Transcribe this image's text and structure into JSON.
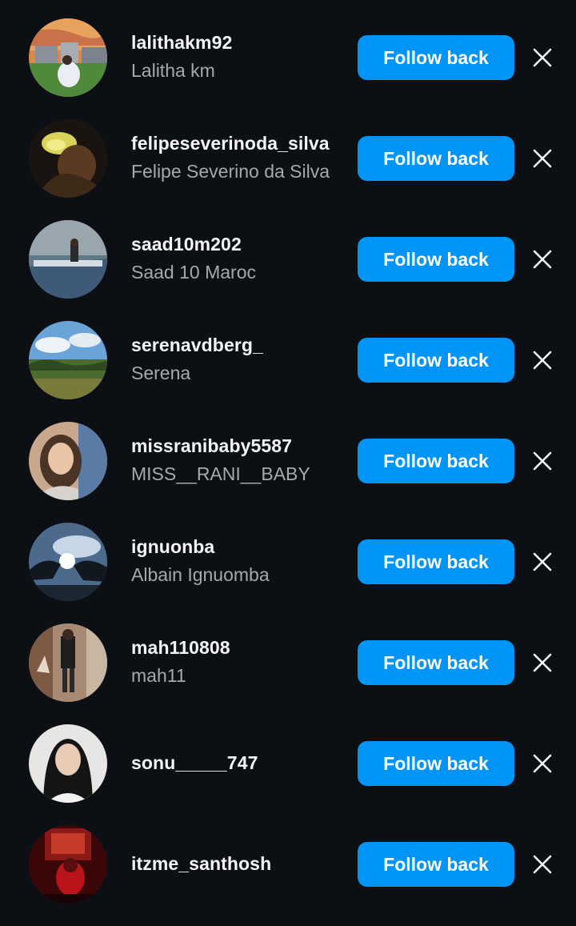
{
  "follow_label": "Follow back",
  "accent_color": "#0095f6",
  "users": [
    {
      "username": "lalithakm92",
      "full_name": "Lalitha km"
    },
    {
      "username": "felipeseverinoda_silva",
      "full_name": "Felipe Severino da Silva"
    },
    {
      "username": "saad10m202",
      "full_name": "Saad 10 Maroc"
    },
    {
      "username": "serenavdberg_",
      "full_name": "Serena"
    },
    {
      "username": "missranibaby5587",
      "full_name": "MISS__RANI__BABY"
    },
    {
      "username": "ignuonba",
      "full_name": "Albain Ignuomba"
    },
    {
      "username": "mah110808",
      "full_name": "mah11"
    },
    {
      "username": "sonu_____747",
      "full_name": ""
    },
    {
      "username": "itzme_santhosh",
      "full_name": ""
    }
  ]
}
